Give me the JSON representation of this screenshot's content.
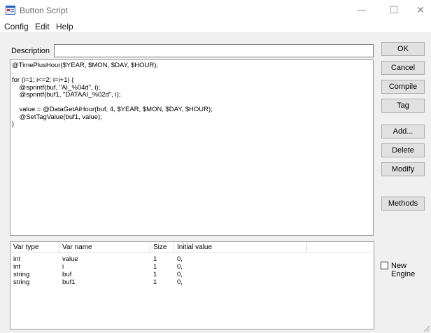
{
  "window": {
    "title": "Button Script"
  },
  "menu": [
    "Config",
    "Edit",
    "Help"
  ],
  "description": {
    "label": "Description",
    "value": ""
  },
  "code": "@TimePlusHour($YEAR, $MON, $DAY, $HOUR);\n\nfor (i=1; i<=2; i=i+1) {\n    @sprintf(buf, \"AI_%04d\", i);\n    @sprintf(buf1, \"DATAAI_%02d\", i);\n\n    value = @DataGetAiHour(buf, 4, $YEAR, $MON, $DAY, $HOUR);\n    @SetTagValue(buf1, value);\n}",
  "buttons": {
    "ok": "OK",
    "cancel": "Cancel",
    "compile": "Compile",
    "tag": "Tag",
    "add": "Add...",
    "delete": "Delete",
    "modify": "Modify",
    "methods": "Methods"
  },
  "vars": {
    "headers": [
      "Var type",
      "Var name",
      "Size",
      "Initial value"
    ],
    "rows": [
      [
        "int",
        "value",
        "1",
        "0,"
      ],
      [
        "int",
        "i",
        "1",
        "0,"
      ],
      [
        "string",
        "buf",
        "1",
        "0,"
      ],
      [
        "string",
        "buf1",
        "1",
        "0,"
      ]
    ]
  },
  "new_engine": {
    "label": "New Engine",
    "checked": false
  },
  "icons": [
    "app-icon",
    "minimize-icon",
    "maximize-icon",
    "close-icon",
    "resize-grip-icon"
  ]
}
